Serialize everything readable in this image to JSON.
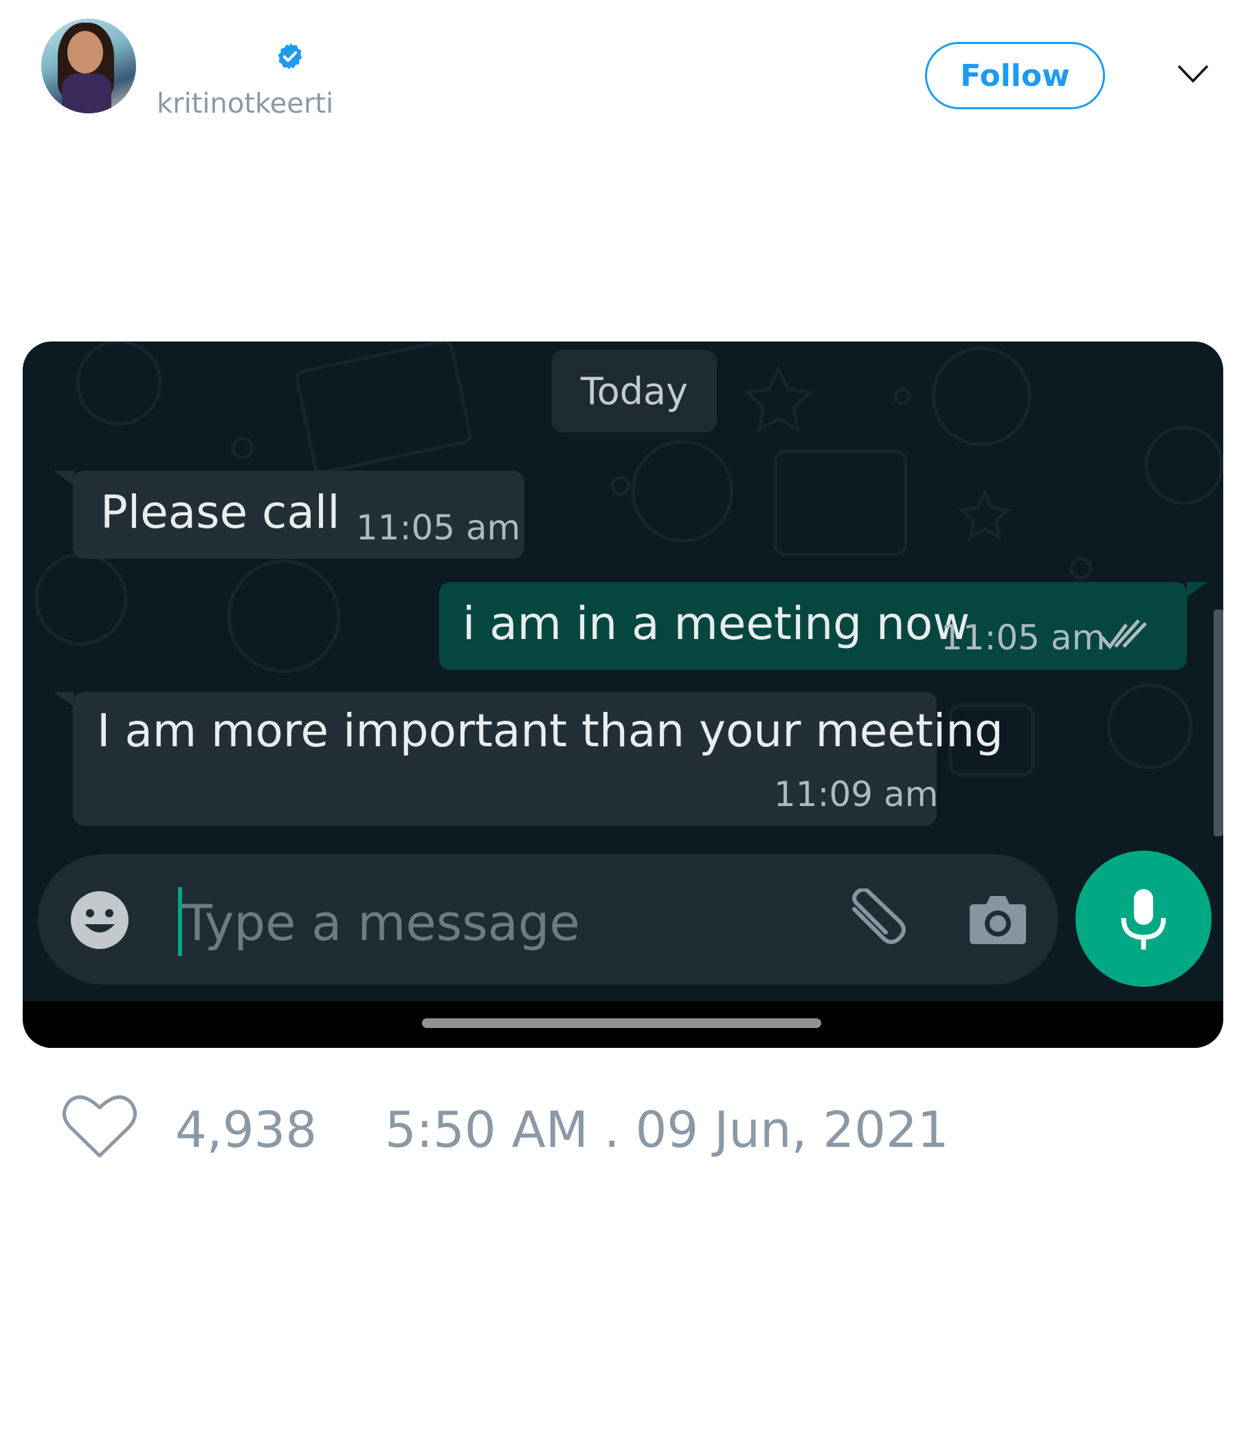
{
  "tweet": {
    "username": "kritinotkeerti",
    "follow_label": "Follow",
    "likes": "4,938",
    "timestamp": "5:50 AM . 09 Jun, 2021",
    "accent_color": "#1d9bf0"
  },
  "chat": {
    "date_label": "Today",
    "messages": [
      {
        "direction": "incoming",
        "text": "Please call",
        "time": "11:05 am"
      },
      {
        "direction": "outgoing",
        "text": "i am in a meeting now",
        "time": "11:05 am",
        "status": "read-double-check"
      },
      {
        "direction": "incoming",
        "text": "I am more important than your meeting",
        "time": "11:09 am"
      }
    ],
    "input_placeholder": "Type a message",
    "icons": [
      "emoji-icon",
      "attach-icon",
      "camera-icon",
      "mic-icon"
    ],
    "colors": {
      "background": "#0c1b21",
      "incoming": "#232f36",
      "outgoing": "#054740",
      "accent": "#00a884"
    }
  }
}
